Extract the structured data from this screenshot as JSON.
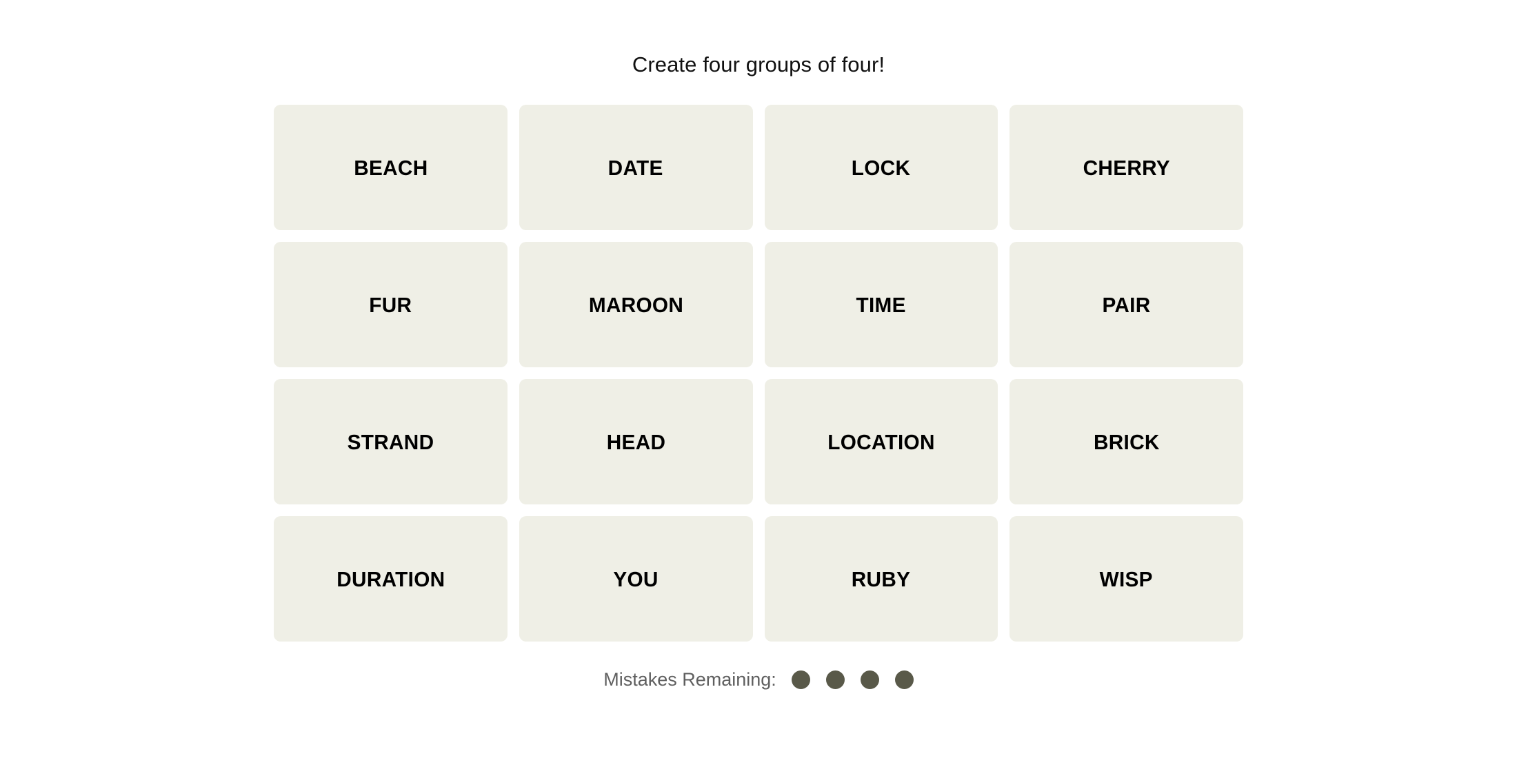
{
  "header": {
    "instruction": "Create four groups of four!"
  },
  "board": {
    "rows": [
      {
        "tiles": [
          {
            "word": "BEACH"
          },
          {
            "word": "DATE"
          },
          {
            "word": "LOCK"
          },
          {
            "word": "CHERRY"
          }
        ]
      },
      {
        "tiles": [
          {
            "word": "FUR"
          },
          {
            "word": "MAROON"
          },
          {
            "word": "TIME"
          },
          {
            "word": "PAIR"
          }
        ]
      },
      {
        "tiles": [
          {
            "word": "STRAND"
          },
          {
            "word": "HEAD"
          },
          {
            "word": "LOCATION"
          },
          {
            "word": "BRICK"
          }
        ]
      },
      {
        "tiles": [
          {
            "word": "DURATION"
          },
          {
            "word": "YOU"
          },
          {
            "word": "RUBY"
          },
          {
            "word": "WISP"
          }
        ]
      }
    ]
  },
  "footer": {
    "mistakes_label": "Mistakes Remaining:",
    "mistakes_remaining": 4,
    "mistakes_total": 4,
    "dot_icon_name": "mistake-dot-icon"
  },
  "colors": {
    "page_background": "#ffffff",
    "tile_background": "#efefe6",
    "tile_text": "#000000",
    "title_text": "#111111",
    "footer_text": "#5f5f5f",
    "dot_fill": "#595949"
  }
}
